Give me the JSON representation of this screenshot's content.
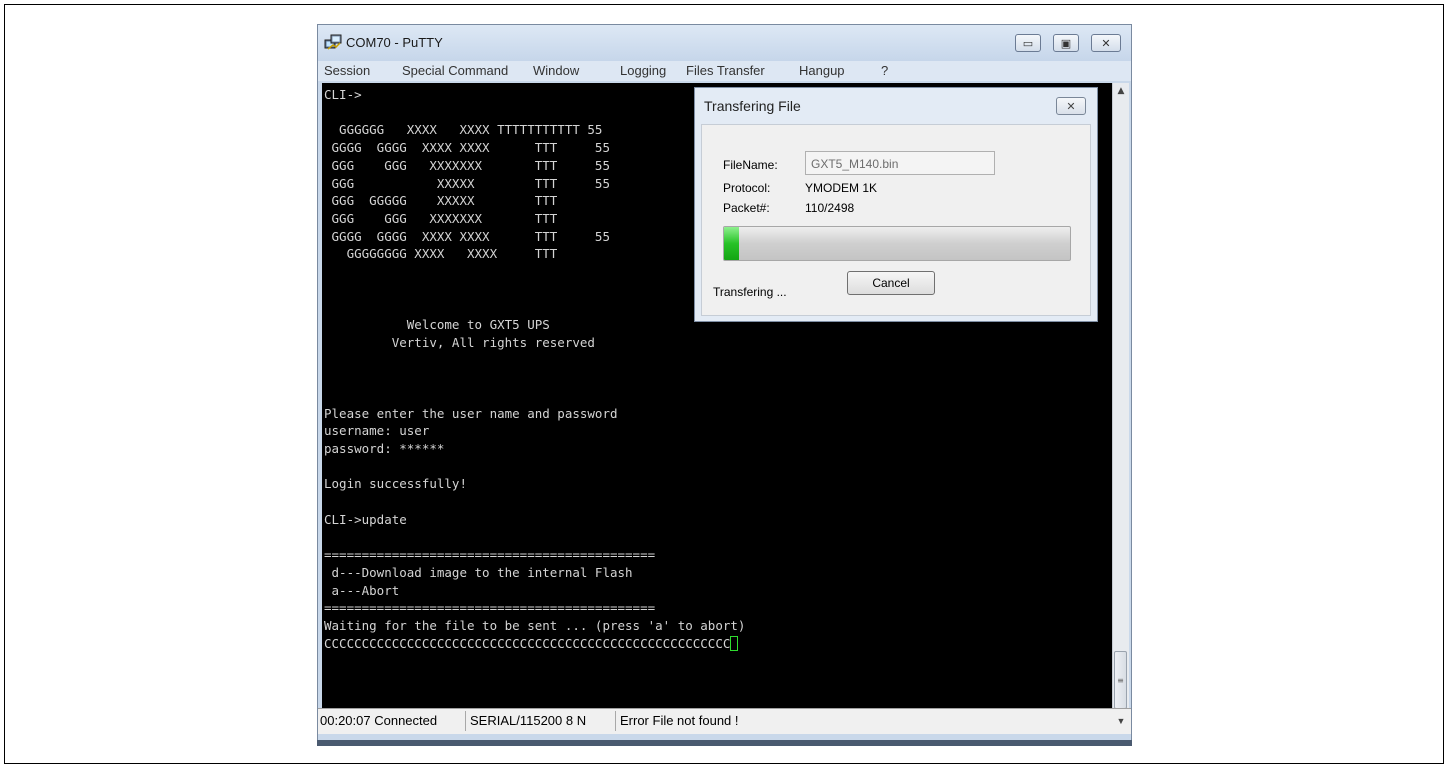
{
  "window": {
    "title": "COM70 - PuTTY",
    "menu": [
      "Session",
      "Special Command",
      "Window",
      "Logging",
      "Files Transfer",
      "Hangup",
      "?"
    ]
  },
  "terminal": {
    "lines": [
      "CLI->",
      "",
      "  GGGGGG   XXXX   XXXX TTTTTTTTTTT 55",
      " GGGG  GGGG  XXXX XXXX      TTT     55",
      " GGG    GGG   XXXXXXX       TTT     55",
      " GGG           XXXXX        TTT     55",
      " GGG  GGGGG    XXXXX        TTT",
      " GGG    GGG   XXXXXXX       TTT",
      " GGGG  GGGG  XXXX XXXX      TTT     55",
      "   GGGGGGGG XXXX   XXXX     TTT",
      "",
      "",
      "",
      "           Welcome to GXT5 UPS",
      "         Vertiv, All rights reserved",
      "",
      "",
      "",
      "Please enter the user name and password",
      "username: user",
      "password: ******",
      "",
      "Login successfully!",
      "",
      "CLI->update",
      "",
      "============================================",
      " d---Download image to the internal Flash",
      " a---Abort",
      "============================================",
      "Waiting for the file to be sent ... (press 'a' to abort)",
      "CCCCCCCCCCCCCCCCCCCCCCCCCCCCCCCCCCCCCCCCCCCCCCCCCCCCCC"
    ]
  },
  "statusbar": {
    "time_status": "00:20:07 Connected",
    "serial": "SERIAL/115200 8 N",
    "message": "Error File not found !"
  },
  "dialog": {
    "title": "Transfering File",
    "filename_label": "FileName:",
    "filename_value": "GXT5_M140.bin",
    "protocol_label": "Protocol:",
    "protocol_value": "YMODEM 1K",
    "packet_label": "Packet#:",
    "packet_value": "110/2498",
    "progress_fraction": 0.044,
    "status_text": "Transfering ...",
    "cancel_label": "Cancel"
  },
  "colors": {
    "progress_fill": "#27c227",
    "terminal_bg": "#000000",
    "terminal_fg": "#d4d4d4",
    "cursor": "#2fdc2f"
  }
}
